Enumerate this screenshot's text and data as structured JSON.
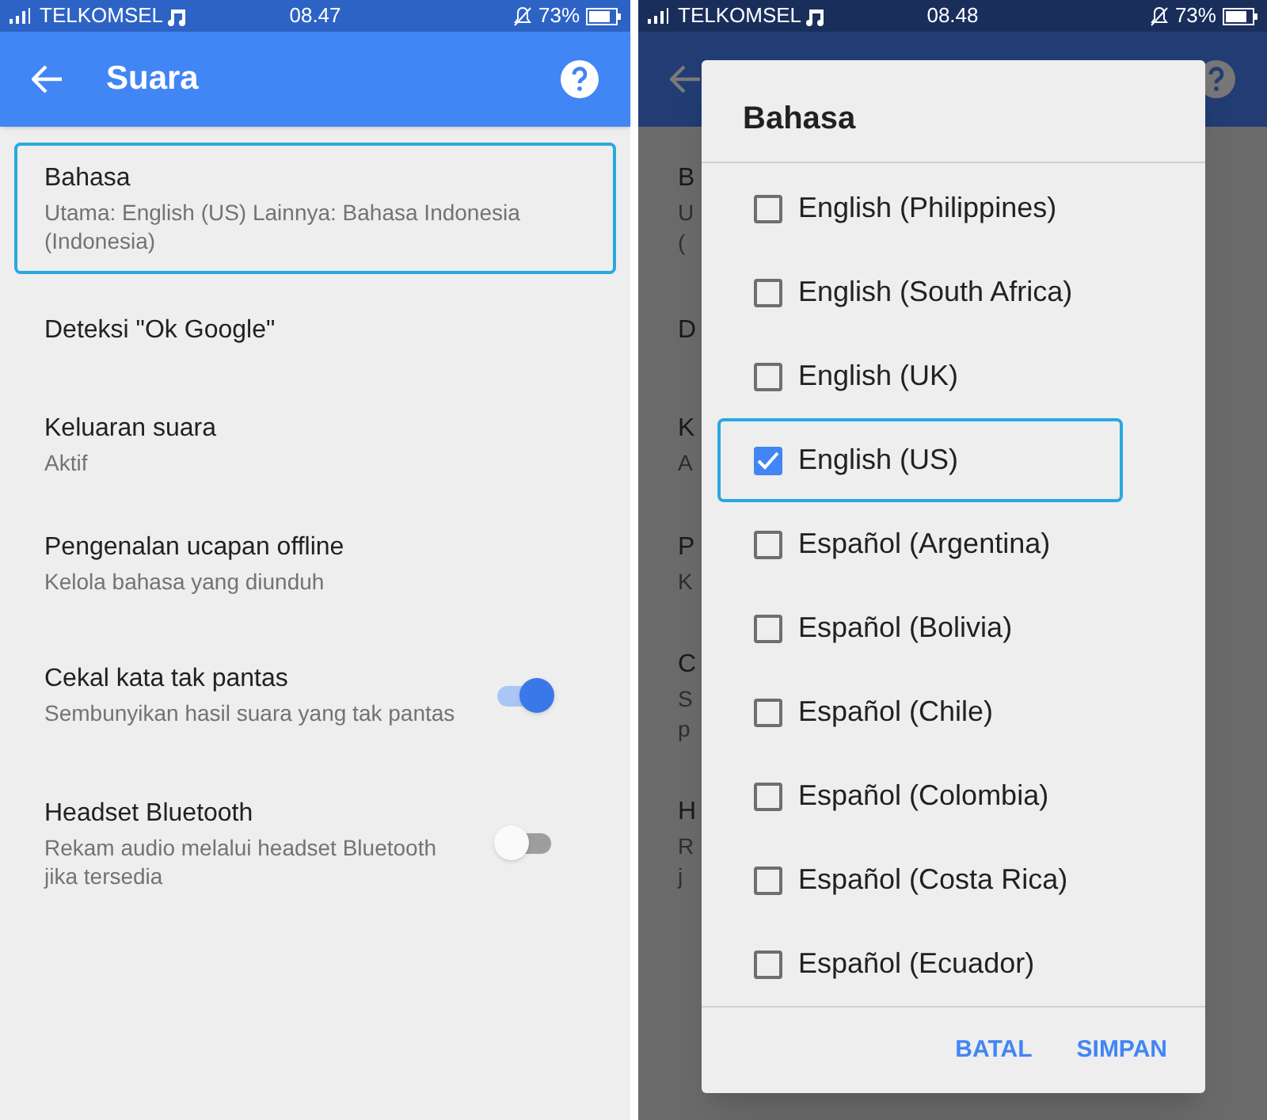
{
  "screens": [
    {
      "status_bar": {
        "carrier": "TELKOMSEL",
        "time": "08.47",
        "battery": "73%"
      },
      "app_bar": {
        "title": "Suara"
      },
      "settings": [
        {
          "title": "Bahasa",
          "subtitle": "Utama: English (US) Lainnya: Bahasa Indonesia (Indonesia)",
          "highlighted": true
        },
        {
          "title": "Deteksi \"Ok Google\"",
          "highlighted": false
        },
        {
          "title": "Keluaran suara",
          "subtitle": "Aktif",
          "highlighted": false
        },
        {
          "title": "Pengenalan ucapan offline",
          "subtitle": "Kelola bahasa yang diunduh",
          "highlighted": false
        },
        {
          "title": "Cekal kata tak pantas",
          "subtitle": "Sembunyikan hasil suara yang tak pantas",
          "highlighted": false,
          "kind": "toggle",
          "on": true
        },
        {
          "title": "Headset Bluetooth",
          "subtitle": "Rekam audio melalui headset Bluetooth jika tersedia",
          "highlighted": false,
          "kind": "toggle",
          "on": false
        }
      ]
    },
    {
      "status_bar": {
        "carrier": "TELKOMSEL",
        "time": "08.48",
        "battery": "73%"
      },
      "background_rows": [
        {
          "lines": [
            "B",
            "U",
            "("
          ]
        },
        {
          "lines": [
            "D"
          ]
        },
        {
          "lines": [
            "K",
            "A"
          ]
        },
        {
          "lines": [
            "P",
            "K"
          ]
        },
        {
          "lines": [
            "C",
            "S",
            "p"
          ]
        },
        {
          "lines": [
            "H",
            "R",
            "j"
          ]
        }
      ],
      "dialog": {
        "title": "Bahasa",
        "options": [
          {
            "label": "English (Philippines)",
            "checked": false,
            "highlighted": false
          },
          {
            "label": "English (South Africa)",
            "checked": false,
            "highlighted": false
          },
          {
            "label": "English (UK)",
            "checked": false,
            "highlighted": false
          },
          {
            "label": "English (US)",
            "checked": true,
            "highlighted": true
          },
          {
            "label": "Español (Argentina)",
            "checked": false,
            "highlighted": false
          },
          {
            "label": "Español (Bolivia)",
            "checked": false,
            "highlighted": false
          },
          {
            "label": "Español (Chile)",
            "checked": false,
            "highlighted": false
          },
          {
            "label": "Español (Colombia)",
            "checked": false,
            "highlighted": false
          },
          {
            "label": "Español (Costa Rica)",
            "checked": false,
            "highlighted": false
          },
          {
            "label": "Español (Ecuador)",
            "checked": false,
            "highlighted": false
          }
        ],
        "buttons": [
          "BATAL",
          "SIMPAN"
        ]
      }
    }
  ]
}
